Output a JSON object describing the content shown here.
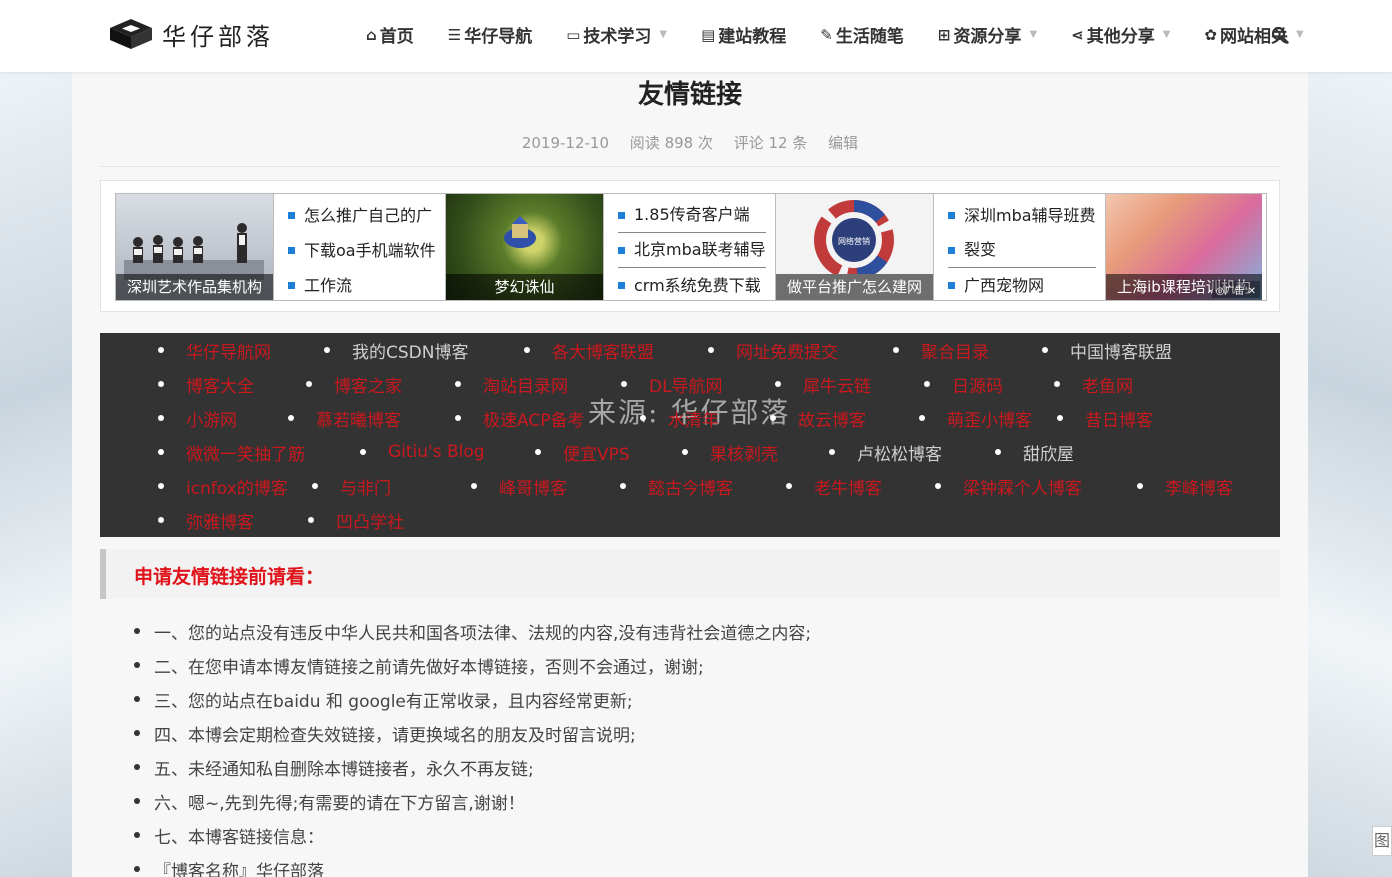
{
  "header": {
    "logo_text": "华仔部落",
    "nav": [
      {
        "icon": "⌂",
        "label": "首页",
        "dropdown": false,
        "icon_name": "home-icon"
      },
      {
        "icon": "☰",
        "label": "华仔导航",
        "dropdown": false,
        "icon_name": "list-icon"
      },
      {
        "icon": "▭",
        "label": "技术学习",
        "dropdown": true,
        "icon_name": "monitor-icon"
      },
      {
        "icon": "▤",
        "label": "建站教程",
        "dropdown": false,
        "icon_name": "book-icon"
      },
      {
        "icon": "✎",
        "label": "生活随笔",
        "dropdown": false,
        "icon_name": "pencil-icon"
      },
      {
        "icon": "⊞",
        "label": "资源分享",
        "dropdown": true,
        "icon_name": "share-square-icon"
      },
      {
        "icon": "⋖",
        "label": "其他分享",
        "dropdown": true,
        "icon_name": "share-icon"
      },
      {
        "icon": "✿",
        "label": "网站相关",
        "dropdown": true,
        "icon_name": "gear-icon"
      }
    ]
  },
  "article": {
    "title": "友情链接",
    "date": "2019-12-10",
    "reads": "阅读 898 次",
    "comments": "评论 12 条",
    "edit": "编辑"
  },
  "ads": {
    "img1_caption": "深圳艺术作品集机构",
    "list1": [
      "怎么推广自己的广",
      "下载oa手机端软件",
      "工作流"
    ],
    "img2_caption": "梦幻诛仙",
    "list2": [
      "1.85传奇客户端",
      "北京mba联考辅导",
      "crm系统免费下载"
    ],
    "img3_caption": "做平台推广怎么建网",
    "img3_ring_text": "网络营销",
    "list3": [
      "深圳mba辅导班费",
      "裂变",
      "广西宠物网"
    ],
    "img4_caption": "上海ib课程培训机构",
    "badge": "◎广告 ✕"
  },
  "links": {
    "watermark": "来源: 华仔部落",
    "rows": [
      [
        {
          "text": "华仔导航网",
          "color": "red"
        },
        {
          "text": "我的CSDN博客",
          "color": "gray"
        },
        {
          "text": "各大博客联盟",
          "color": "red"
        },
        {
          "text": "网址免费提交",
          "color": "red"
        },
        {
          "text": "聚合目录",
          "color": "red"
        },
        {
          "text": "中国博客联盟",
          "color": "gray"
        }
      ],
      [
        {
          "text": "博客大全",
          "color": "red"
        },
        {
          "text": "博客之家",
          "color": "red"
        },
        {
          "text": "淘站目录网",
          "color": "red"
        },
        {
          "text": "DL导航网",
          "color": "red"
        },
        {
          "text": "犀牛云链",
          "color": "red"
        },
        {
          "text": "日源码",
          "color": "red"
        },
        {
          "text": "老鱼网",
          "color": "red"
        }
      ],
      [
        {
          "text": "小游网",
          "color": "red"
        },
        {
          "text": "慕若曦博客",
          "color": "red"
        },
        {
          "text": "极速ACP备考",
          "color": "red"
        },
        {
          "text": "水清年",
          "color": "red"
        },
        {
          "text": "故云博客",
          "color": "red"
        },
        {
          "text": "萌歪小博客",
          "color": "red"
        },
        {
          "text": "昔日博客",
          "color": "red"
        }
      ],
      [
        {
          "text": "微微一笑抽了筋",
          "color": "red"
        },
        {
          "text": "Gitiu's Blog",
          "color": "red"
        },
        {
          "text": "便宜VPS",
          "color": "red"
        },
        {
          "text": "果核剥壳",
          "color": "red"
        },
        {
          "text": "卢松松博客",
          "color": "gray"
        },
        {
          "text": "甜欣屋",
          "color": "gray"
        }
      ],
      [
        {
          "text": "icnfox的博客",
          "color": "red"
        },
        {
          "text": "与非门",
          "color": "red"
        },
        {
          "text": "峰哥博客",
          "color": "red"
        },
        {
          "text": "懿古今博客",
          "color": "red"
        },
        {
          "text": "老牛博客",
          "color": "red"
        },
        {
          "text": "梁钟霖个人博客",
          "color": "red"
        },
        {
          "text": "李峰博客",
          "color": "red"
        }
      ],
      [
        {
          "text": "弥雅博客",
          "color": "red"
        },
        {
          "text": "凹凸学社",
          "color": "red"
        }
      ]
    ]
  },
  "notice": {
    "heading": "申请友情链接前请看：",
    "rules": [
      "一、您的站点没有违反中华人民共和国各项法律、法规的内容,没有违背社会道德之内容;",
      "二、在您申请本博友情链接之前请先做好本博链接，否则不会通过，谢谢;",
      "三、您的站点在baidu 和 google有正常收录，且内容经常更新;",
      "四、本博会定期检查失效链接，请更换域名的朋友及时留言说明;",
      "五、未经通知私自删除本博链接者，永久不再友链;",
      "六、嗯~,先到先得;有需要的请在下方留言,谢谢！",
      "七、本博客链接信息：",
      "『博客名称』华仔部落"
    ]
  },
  "corner_tag": "图",
  "colors": {
    "link_red": "#c9181e",
    "notice_red": "#e0121a",
    "links_bg": "#333333",
    "ad_square": "#1e7fd6"
  }
}
